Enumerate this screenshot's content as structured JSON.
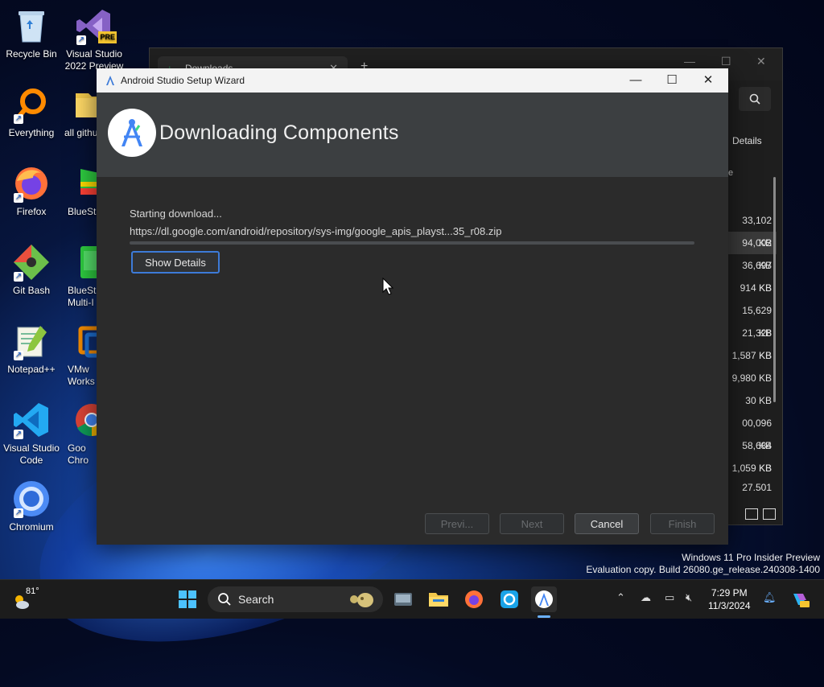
{
  "desktop": {
    "icons": [
      {
        "label": "Recycle Bin"
      },
      {
        "label": "Visual Studio 2022 Preview",
        "badge": "PRE"
      },
      {
        "label": "Everything"
      },
      {
        "label": "all githu"
      },
      {
        "label": "Firefox"
      },
      {
        "label": "BlueSta"
      },
      {
        "label": "Git Bash"
      },
      {
        "label": "BlueSt Multi-I"
      },
      {
        "label": "Notepad++"
      },
      {
        "label": "VMw Works"
      },
      {
        "label": "Visual Studio Code"
      },
      {
        "label": "Goo Chro"
      },
      {
        "label": "Chromium"
      }
    ]
  },
  "bg_window": {
    "tab_title": "Downloads",
    "details_label": "Details",
    "column_fragment": "e",
    "sizes": [
      "33,102 KB",
      "94,002 KB",
      "36,697 KB",
      "914 KB",
      "15,629 KB",
      "21,328 KB",
      "1,587 KB",
      "9,980 KB",
      "30 KB",
      "00,096 KB",
      "58,684 KB",
      "1,059 KB",
      "27,501 KB"
    ]
  },
  "dialog": {
    "window_title": "Android Studio Setup Wizard",
    "header_title": "Downloading Components",
    "status_text": "Starting download...",
    "url_text": "https://dl.google.com/android/repository/sys-img/google_apis_playst...35_r08.zip",
    "progress": 0.0,
    "show_details_label": "Show Details",
    "buttons": {
      "previous": "Previ...",
      "next": "Next",
      "cancel": "Cancel",
      "finish": "Finish"
    }
  },
  "watermark": {
    "line1": "Windows 11 Pro Insider Preview",
    "line2": "Evaluation copy. Build 26080.ge_release.240308-1400"
  },
  "taskbar": {
    "weather_temp": "81°",
    "search_label": "Search",
    "clock_time": "7:29 PM",
    "clock_date": "11/3/2024"
  },
  "colors": {
    "accent": "#3d7bd8",
    "dialog_bg": "#2b2b2b",
    "header_bg": "#3c3f41"
  }
}
